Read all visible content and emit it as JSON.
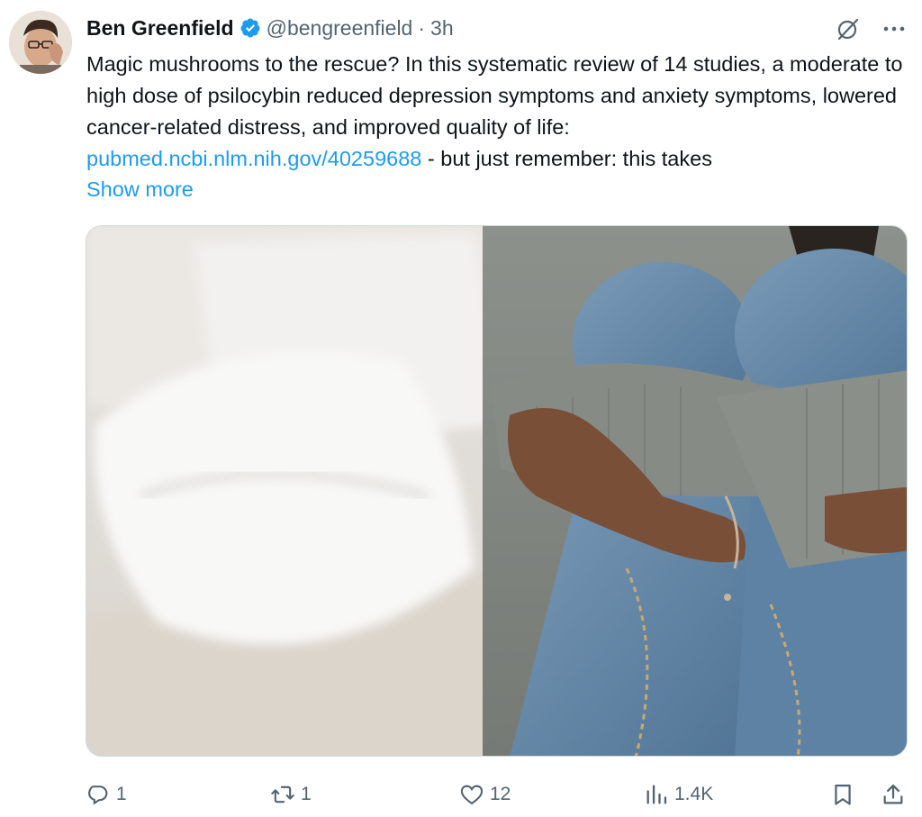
{
  "author": {
    "name": "Ben Greenfield",
    "handle": "@bengreenfield",
    "separator": "·",
    "time": "3h"
  },
  "tweet": {
    "text_before_link": "Magic mushrooms to the rescue? In this systematic review of 14 studies, a moderate to high dose of psilocybin reduced depression symptoms and anxiety symptoms, lowered cancer-related distress, and improved quality of life: ",
    "link_text": "pubmed.ncbi.nlm.nih.gov/40259688",
    "text_after_link": " - but just remember: this takes",
    "show_more": "Show more"
  },
  "actions": {
    "replies": "1",
    "reposts": "1",
    "likes": "12",
    "views": "1.4K"
  },
  "icons": {
    "verified": "verified-badge-icon",
    "grok": "grok-icon",
    "more": "more-icon",
    "reply": "reply-icon",
    "repost": "repost-icon",
    "like": "heart-icon",
    "views": "views-icon",
    "bookmark": "bookmark-icon",
    "share": "share-icon"
  },
  "colors": {
    "text": "#0f1419",
    "secondary": "#536471",
    "link": "#1d9bf0",
    "verified": "#1d9bf0"
  }
}
